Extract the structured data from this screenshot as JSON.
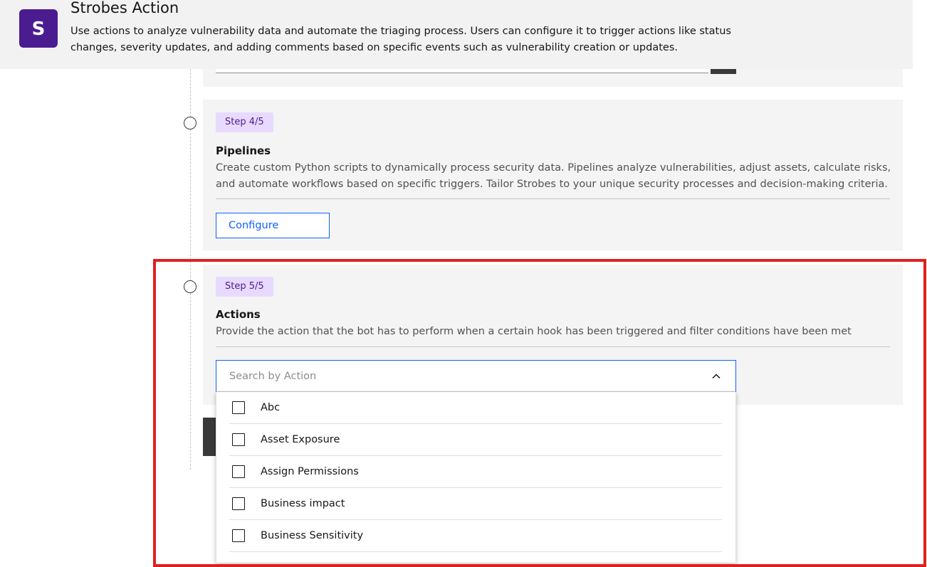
{
  "header": {
    "logo_letter": "S",
    "title": "Strobes Action",
    "description": "Use actions to analyze vulnerability data and automate the triaging process. Users can configure it to trigger actions like status changes, severity updates, and adding comments based on specific events such as vulnerability creation or updates."
  },
  "steps": [
    {
      "badge": "Step 4/5",
      "title": "Pipelines",
      "description": "Create custom Python scripts to dynamically process security data. Pipelines analyze vulnerabilities, adjust assets, calculate risks, and automate workflows based on specific triggers. Tailor Strobes to your unique security processes and decision-making criteria.",
      "button_label": "Configure"
    },
    {
      "badge": "Step 5/5",
      "title": "Actions",
      "description": "Provide the action that the bot has to perform when a certain hook has been triggered and filter conditions have been met"
    }
  ],
  "action_search": {
    "placeholder": "Search by Action",
    "options": [
      {
        "label": "Abc",
        "checked": false
      },
      {
        "label": "Asset Exposure",
        "checked": false
      },
      {
        "label": "Assign Permissions",
        "checked": false
      },
      {
        "label": "Business impact",
        "checked": false
      },
      {
        "label": "Business Sensitivity",
        "checked": false
      }
    ]
  },
  "colors": {
    "brand": "#4b1c8f",
    "accent": "#0f62fe",
    "badge_bg": "#e8daff",
    "highlight": "#e0201f"
  }
}
